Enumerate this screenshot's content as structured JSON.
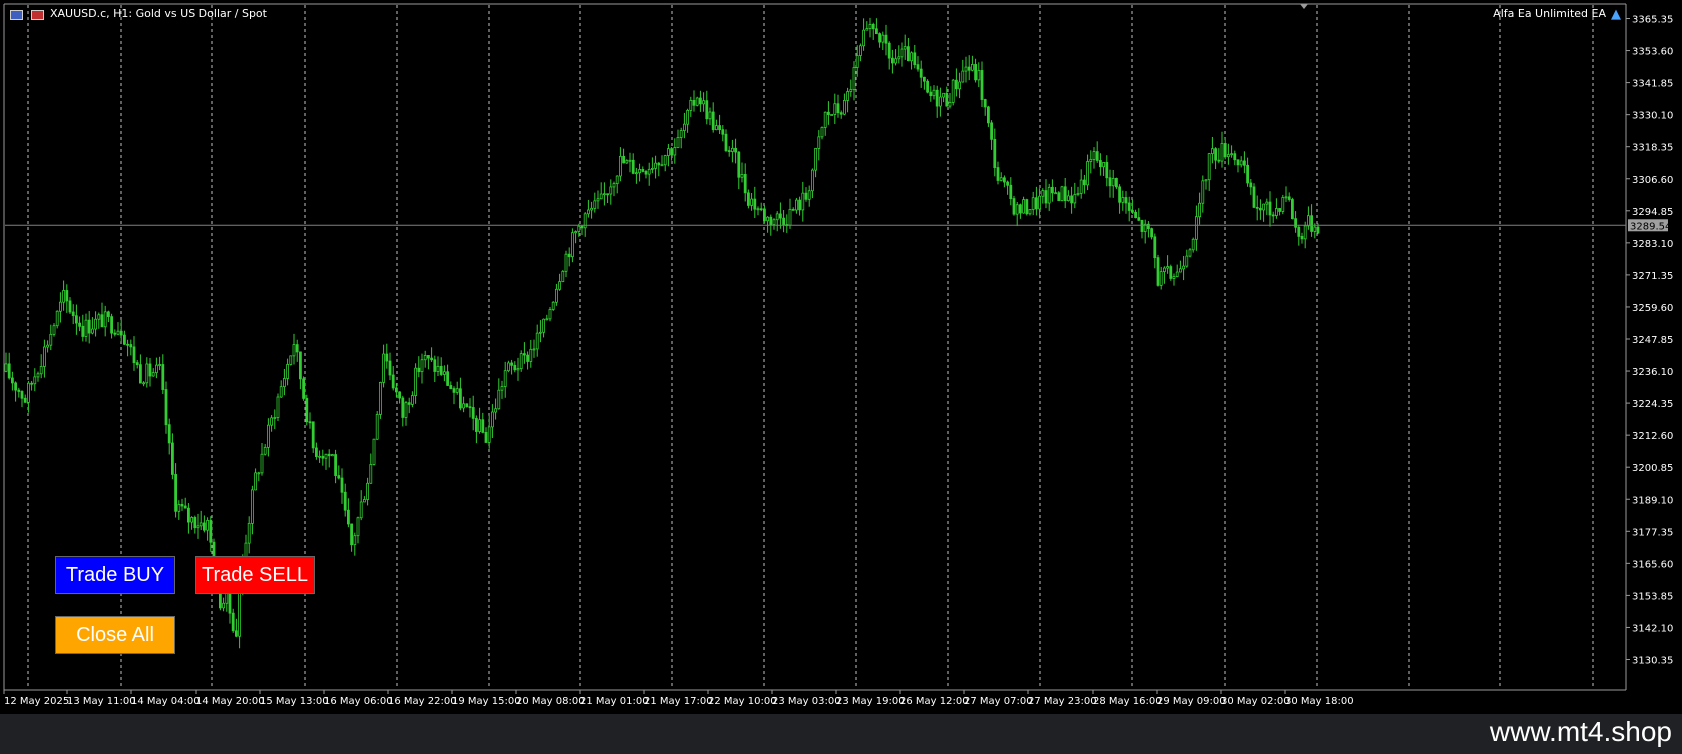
{
  "header": {
    "symbol_info": "XAUUSD.c, H1:  Gold vs US Dollar / Spot",
    "ea_name": "Alfa Ea Unlimited EA"
  },
  "buttons": {
    "buy": "Trade BUY",
    "sell": "Trade SELL",
    "close_all": "Close All"
  },
  "watermark": "www.mt4.shop",
  "colors": {
    "background": "#000000",
    "candles": "#32cd32",
    "grid": "#c0c0c0",
    "bid_line": "#808080",
    "buy_button": "#0000ff",
    "sell_button": "#ff0000",
    "close_button": "#ffa500",
    "footer": "#202124"
  },
  "chart_data": {
    "type": "candlestick",
    "ylim": [
      3122.5,
      3369.5
    ],
    "y_ticks": [
      "3365.35",
      "3353.60",
      "3341.85",
      "3330.10",
      "3318.35",
      "3306.60",
      "3294.85",
      "3283.10",
      "3271.35",
      "3259.60",
      "3247.85",
      "3236.10",
      "3224.35",
      "3212.60",
      "3200.85",
      "3189.10",
      "3177.35",
      "3165.60",
      "3153.85",
      "3142.10",
      "3130.35"
    ],
    "x_ticks": [
      "12 May 2025",
      "13 May 11:00",
      "14 May 04:00",
      "14 May 20:00",
      "15 May 13:00",
      "16 May 06:00",
      "16 May 22:00",
      "19 May 15:00",
      "20 May 08:00",
      "21 May 01:00",
      "21 May 17:00",
      "22 May 10:00",
      "23 May 03:00",
      "23 May 19:00",
      "26 May 12:00",
      "27 May 07:00",
      "27 May 23:00",
      "28 May 16:00",
      "29 May 09:00",
      "30 May 02:00",
      "30 May 18:00"
    ],
    "current_price": "3289.54",
    "grid": "vertical dashed",
    "close_path": [
      [
        0,
        3236
      ],
      [
        6,
        3226
      ],
      [
        12,
        3244
      ],
      [
        18,
        3263
      ],
      [
        24,
        3252
      ],
      [
        30,
        3255
      ],
      [
        36,
        3252
      ],
      [
        42,
        3235
      ],
      [
        48,
        3236
      ],
      [
        53,
        3188
      ],
      [
        57,
        3182
      ],
      [
        63,
        3180
      ],
      [
        67,
        3152
      ],
      [
        69,
        3152
      ],
      [
        72,
        3140
      ],
      [
        74,
        3168
      ],
      [
        78,
        3197
      ],
      [
        84,
        3222
      ],
      [
        90,
        3247
      ],
      [
        96,
        3208
      ],
      [
        102,
        3205
      ],
      [
        108,
        3172
      ],
      [
        114,
        3202
      ],
      [
        118,
        3244
      ],
      [
        124,
        3220
      ],
      [
        130,
        3241
      ],
      [
        136,
        3236
      ],
      [
        144,
        3221
      ],
      [
        150,
        3212
      ],
      [
        156,
        3236
      ],
      [
        162,
        3240
      ],
      [
        168,
        3252
      ],
      [
        174,
        3276
      ],
      [
        180,
        3292
      ],
      [
        186,
        3298
      ],
      [
        192,
        3313
      ],
      [
        198,
        3310
      ],
      [
        204,
        3314
      ],
      [
        210,
        3320
      ],
      [
        216,
        3338
      ],
      [
        222,
        3325
      ],
      [
        228,
        3313
      ],
      [
        232,
        3300
      ],
      [
        238,
        3292
      ],
      [
        244,
        3293
      ],
      [
        250,
        3300
      ],
      [
        256,
        3330
      ],
      [
        262,
        3333
      ],
      [
        268,
        3358
      ],
      [
        272,
        3362
      ],
      [
        276,
        3350
      ],
      [
        282,
        3352
      ],
      [
        288,
        3337
      ],
      [
        294,
        3336
      ],
      [
        300,
        3348
      ],
      [
        304,
        3344
      ],
      [
        310,
        3307
      ],
      [
        316,
        3295
      ],
      [
        322,
        3298
      ],
      [
        328,
        3302
      ],
      [
        334,
        3300
      ],
      [
        340,
        3315
      ],
      [
        346,
        3305
      ],
      [
        352,
        3293
      ],
      [
        358,
        3285
      ],
      [
        360,
        3270
      ],
      [
        366,
        3272
      ],
      [
        372,
        3290
      ],
      [
        376,
        3315
      ],
      [
        382,
        3318
      ],
      [
        386,
        3312
      ],
      [
        390,
        3297
      ],
      [
        396,
        3294
      ],
      [
        400,
        3302
      ],
      [
        404,
        3285
      ],
      [
        406,
        3290
      ],
      [
        410,
        3290
      ]
    ]
  }
}
